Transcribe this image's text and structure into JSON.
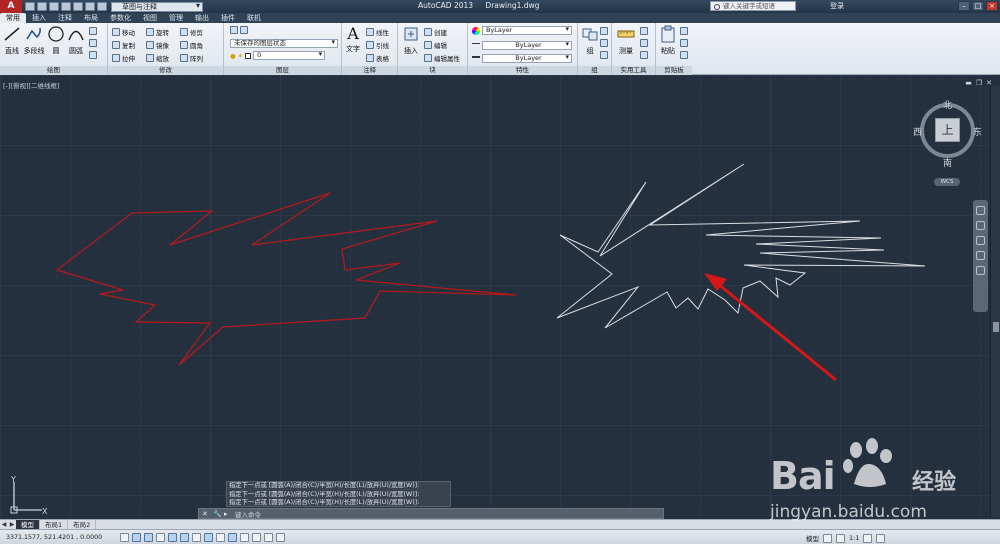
{
  "titlebar": {
    "app_logo": "A",
    "workspace": "草图与注释",
    "app_name": "AutoCAD 2013",
    "filename": "Drawing1.dwg",
    "search_placeholder": "键入关键字或短语",
    "login": "登录"
  },
  "tabs": [
    "常用",
    "插入",
    "注释",
    "布局",
    "参数化",
    "视图",
    "管理",
    "输出",
    "插件",
    "联机"
  ],
  "ribbon": {
    "draw": {
      "title": "绘图",
      "line": "直线",
      "polyline": "多段线",
      "circle": "圆",
      "arc": "圆弧"
    },
    "modify": {
      "title": "修改",
      "move": "移动",
      "rotate": "旋转",
      "trim": "修剪",
      "copy": "复制",
      "mirror": "镜像",
      "fillet": "圆角",
      "stretch": "拉伸",
      "scale": "缩放",
      "array": "阵列"
    },
    "layers": {
      "title": "图层",
      "state": "未保存的图层状态",
      "current": "0"
    },
    "annotation": {
      "title": "注释",
      "text": "文字",
      "linear": "线性",
      "leader": "引线",
      "table": "表格"
    },
    "block": {
      "title": "块",
      "insert": "插入",
      "create": "创建",
      "edit": "编辑",
      "edit_attr": "编辑属性"
    },
    "properties": {
      "title": "特性",
      "color": "ByLayer",
      "linetype": "ByLayer",
      "lineweight": "ByLayer"
    },
    "groups": {
      "title": "组",
      "group": "组"
    },
    "utilities": {
      "title": "实用工具",
      "measure": "测量"
    },
    "clipboard": {
      "title": "剪贴板",
      "paste": "粘贴"
    }
  },
  "viewport": {
    "title": "[-][俯视][二维线框]"
  },
  "viewcube": {
    "north": "北",
    "south": "南",
    "east": "东",
    "west": "西",
    "top": "上",
    "wcs": "WCS"
  },
  "ucs": {
    "x": "X",
    "y": "Y"
  },
  "command": {
    "history": [
      "指定下一点或 [圆弧(A)/闭合(C)/半宽(H)/长度(L)/放弃(U)/宽度(W)]:",
      "指定下一点或 [圆弧(A)/闭合(C)/半宽(H)/长度(L)/放弃(U)/宽度(W)]:",
      "指定下一点或 [圆弧(A)/闭合(C)/半宽(H)/长度(L)/放弃(U)/宽度(W)]:"
    ],
    "input_placeholder": "键入命令"
  },
  "layout_tabs": [
    "模型",
    "布局1",
    "布局2"
  ],
  "status": {
    "coords": "3371.1577, 521.4201 , 0.0000",
    "model": "模型",
    "scale": "1:1"
  },
  "colors": {
    "red_shape": "#b5191d",
    "white_shape": "#d8dde2",
    "arrow": "#d41717",
    "canvas": "#25303e"
  },
  "watermark": {
    "brand": "Bai 经验",
    "brand_prefix": "Bai",
    "brand_suffix": "经验",
    "url": "jingyan.baidu.com"
  }
}
